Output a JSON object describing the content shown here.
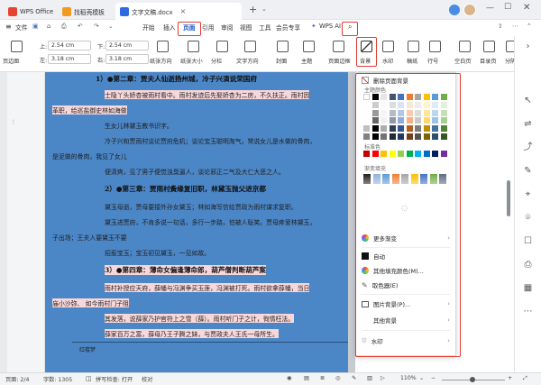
{
  "tabs": [
    {
      "label": "WPS Office"
    },
    {
      "label": "找稻壳模板"
    },
    {
      "label": "文字文稿.docx"
    }
  ],
  "ribbon": {
    "menu_label": "文件",
    "tabs": [
      "开始",
      "插入",
      "页面",
      "引用",
      "审阅",
      "视图",
      "工具",
      "会员专享"
    ],
    "ai_label": "WPS AI",
    "active_tab": "页面"
  },
  "toolbar": {
    "margin_top": "2.54",
    "margin_bottom": "2.54",
    "margin_left": "3.18",
    "margin_right": "3.18",
    "unit": "cm",
    "labels": [
      "页边距",
      "纸张方向",
      "纸张大小",
      "分栏",
      "文字方向",
      "页面边框",
      "背景",
      "水印",
      "稿纸",
      "行号",
      "空白页",
      "目录页",
      "分隔"
    ],
    "short_labels": [
      "上:",
      "下:",
      "左:",
      "右:",
      "封面",
      "主题"
    ]
  },
  "document": {
    "lines": [
      "1）●第二章：贾夫人仙逝扬州城，冷子兴演说荣国府",
      "士隐丫头娇杏被雨村看中。雨村发迹后先娶娇杏为二房，不久扶正。雨村因",
      "革职，给巡盐御史林如海做",
      "生女儿林黛玉教书识字。",
      "冷子兴和贾雨村谈论贾府危机；谈论宝玉聪明淘气，常说女儿是水做的骨肉，",
      "是泥做的骨肉，我见了女儿",
      "便清爽，见了男子便觉浊臭逼人，谈论邪正二气及大仁大恶之人。",
      "2）●第三章：贾雨村夤缘复旧职，林黛玉抛父进京都",
      "黛玉母逝，贾母要接外孙女黛玉；林如海写信给贾政为雨村谋求复职。",
      "黛玉进贾府，不肯多说一句话，多行一步路，怕被人耻笑。贾母疼爱林黛玉，",
      "子出场；王夫人要黛玉不要",
      "招惹宝玉；宝玉初见黛玉，一见如故。",
      "3）●第四章：薄命女偏逢薄命郎，葫芦僧判断葫芦案",
      "雨村补授应天府，薛蟠与冯渊争买玉莲，冯渊被打死。雨村欲拿薛蟠，当日",
      "庙小沙弥、  如今雨村门子阻",
      "其发落，说薛家乃护官符上之雪（薛）。雨村听门子之计，徇情枉法。",
      "薛家百万之富，薛母乃王子腾之妹，与贾政夫人王氏一母所生。"
    ],
    "footer_label": "红楼梦"
  },
  "background_menu": {
    "remove_label": "删除页面背景",
    "theme_colors_label": "主题颜色",
    "standard_colors_label": "标准色",
    "gradient_label": "渐变填充",
    "items": [
      {
        "label": "更多渐变"
      },
      {
        "label": "自动"
      },
      {
        "label": "其他填充颜色(M)..."
      },
      {
        "label": "取色器(E)"
      },
      {
        "label": "图片背景(P)..."
      },
      {
        "label": "其他背景"
      },
      {
        "label": "水印"
      }
    ],
    "theme_top_row": [
      "#ffffff",
      "#000000",
      "#e7e6e6",
      "#44546a",
      "#4472c4",
      "#ed7d31",
      "#a5a5a5",
      "#ffc000",
      "#5b9bd5",
      "#70ad47"
    ],
    "standard_colors": [
      "#c00000",
      "#ff0000",
      "#ffc000",
      "#ffff00",
      "#92d050",
      "#00b050",
      "#00b0f0",
      "#0070c0",
      "#002060",
      "#7030a0"
    ],
    "gradient_colors": [
      "#1f1f1f",
      "#8fb2e0",
      "#5b9bd5",
      "#ed7d31",
      "#a5a5a5",
      "#ffc000",
      "#4472c4",
      "#70ad47",
      "#5b6b7f"
    ]
  },
  "status": {
    "page": "页面: 2/4",
    "words": "字数: 1305",
    "spell": "拼写检查: 打开",
    "proof": "校对",
    "zoom": "110%"
  }
}
